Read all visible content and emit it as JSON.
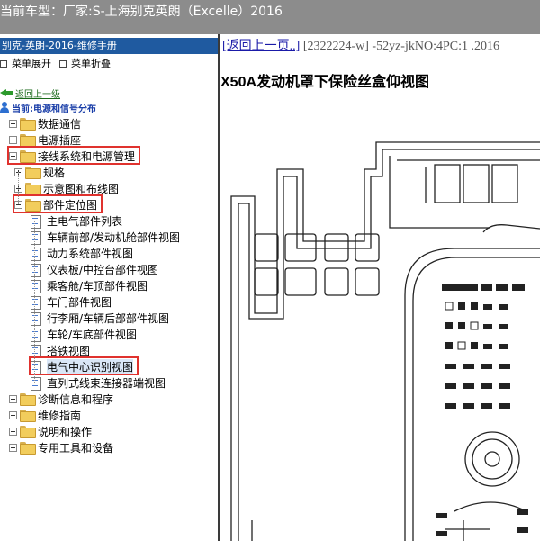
{
  "header": {
    "car_model_label": "当前车型：",
    "car_model_value": "厂家:S-上海别克英朗（Excelle）2016"
  },
  "left_panel": {
    "title": "别克-英朗-2016-维修手册",
    "expand_all": "菜单展开",
    "collapse_all": "菜单折叠",
    "back_link": "返回上一级",
    "current": "当前:电源和信号分布",
    "tree": [
      {
        "label": "数据通信",
        "level": 0,
        "type": "folder",
        "expander": "plus"
      },
      {
        "label": "电源插座",
        "level": 0,
        "type": "folder",
        "expander": "plus"
      },
      {
        "label": "接线系统和电源管理",
        "level": 0,
        "type": "folder",
        "expander": "minus",
        "highlighted": true
      },
      {
        "label": "规格",
        "level": 1,
        "type": "folder",
        "expander": "plus"
      },
      {
        "label": "示意图和布线图",
        "level": 1,
        "type": "folder",
        "expander": "plus"
      },
      {
        "label": "部件定位图",
        "level": 1,
        "type": "folder",
        "expander": "minus",
        "highlighted": true
      },
      {
        "label": "主电气部件列表",
        "level": 2,
        "type": "doc"
      },
      {
        "label": "车辆前部/发动机舱部件视图",
        "level": 2,
        "type": "doc"
      },
      {
        "label": "动力系统部件视图",
        "level": 2,
        "type": "doc"
      },
      {
        "label": "仪表板/中控台部件视图",
        "level": 2,
        "type": "doc"
      },
      {
        "label": "乘客舱/车顶部件视图",
        "level": 2,
        "type": "doc"
      },
      {
        "label": "车门部件视图",
        "level": 2,
        "type": "doc"
      },
      {
        "label": "行李厢/车辆后部部件视图",
        "level": 2,
        "type": "doc"
      },
      {
        "label": "车轮/车底部件视图",
        "level": 2,
        "type": "doc"
      },
      {
        "label": "搭铁视图",
        "level": 2,
        "type": "doc"
      },
      {
        "label": "电气中心识别视图",
        "level": 2,
        "type": "doc",
        "highlighted": true,
        "selected": true
      },
      {
        "label": "直列式线束连接器端视图",
        "level": 2,
        "type": "doc"
      },
      {
        "label": "诊断信息和程序",
        "level": 0,
        "type": "folder",
        "expander": "plus"
      },
      {
        "label": "维修指南",
        "level": 0,
        "type": "folder",
        "expander": "plus"
      },
      {
        "label": "说明和操作",
        "level": 0,
        "type": "folder",
        "expander": "plus"
      },
      {
        "label": "专用工具和设备",
        "level": 0,
        "type": "folder",
        "expander": "plus"
      }
    ]
  },
  "content": {
    "back_link": "[返回上一页..]",
    "doc_code": "[2322224-w] -52yz-jkNO:4PC:1 .2016",
    "title": "X50A发动机罩下保险丝盒仰视图"
  },
  "colors": {
    "header_bg": "#8c8c8c",
    "panel_title_bg": "#1f5aa0",
    "highlight_box": "#e0322e",
    "divider": "#3a3a3a"
  }
}
